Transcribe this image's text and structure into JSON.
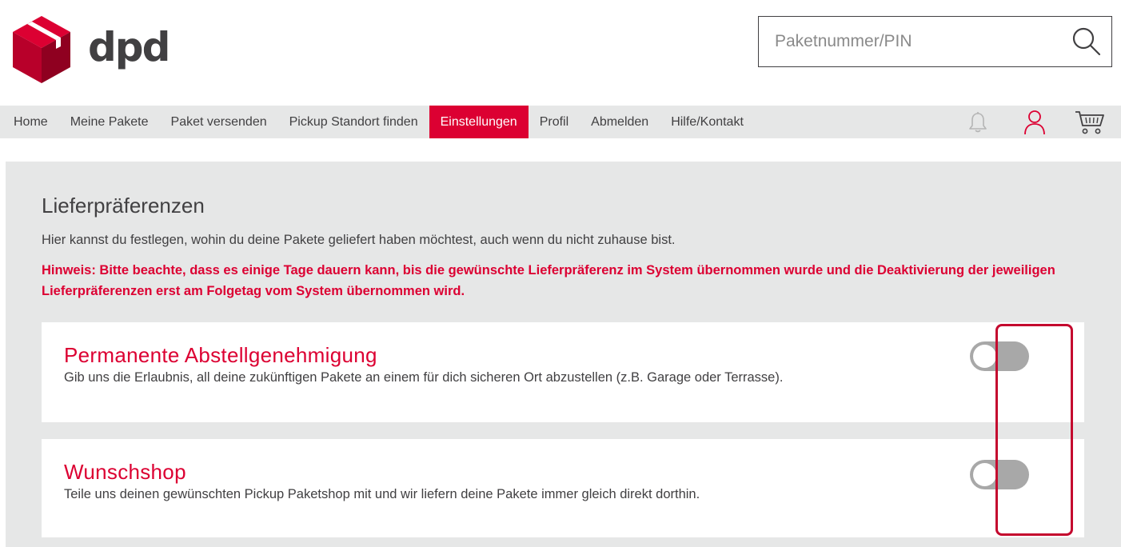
{
  "brand": {
    "name": "dpd",
    "accent": "#dc0032",
    "text_color": "#414042",
    "grey_bg": "#e6e7e7"
  },
  "search": {
    "placeholder": "Paketnummer/PIN",
    "value": "",
    "icon": "search-icon"
  },
  "nav": {
    "items": [
      {
        "label": "Home",
        "active": false
      },
      {
        "label": "Meine Pakete",
        "active": false
      },
      {
        "label": "Paket versenden",
        "active": false
      },
      {
        "label": "Pickup Standort finden",
        "active": false
      },
      {
        "label": "Einstellungen",
        "active": true
      },
      {
        "label": "Profil",
        "active": false
      },
      {
        "label": "Abmelden",
        "active": false
      },
      {
        "label": "Hilfe/Kontakt",
        "active": false
      }
    ],
    "icons": [
      "bell-icon",
      "user-icon",
      "cart-icon"
    ]
  },
  "main": {
    "title": "Lieferpräferenzen",
    "intro": "Hier kannst du festlegen, wohin du deine Pakete geliefert haben möchtest, auch wenn du nicht zuhause bist.",
    "hint": "Hinweis: Bitte beachte, dass es einige Tage dauern kann, bis die gewünschte Lieferpräferenz im System übernommen wurde und die Deaktivierung der jeweiligen Lieferpräferenzen erst am Folgetag vom System übernommen wird.",
    "preferences": [
      {
        "title": "Permanente Abstellgenehmigung",
        "description": "Gib uns die Erlaubnis, all deine zukünftigen Pakete an einem für dich sicheren Ort abzustellen (z.B. Garage oder Terrasse).",
        "enabled": false
      },
      {
        "title": "Wunschshop",
        "description": "Teile uns deinen gewünschten Pickup Paketshop mit und wir liefern deine Pakete immer gleich direkt dorthin.",
        "enabled": false
      }
    ]
  }
}
